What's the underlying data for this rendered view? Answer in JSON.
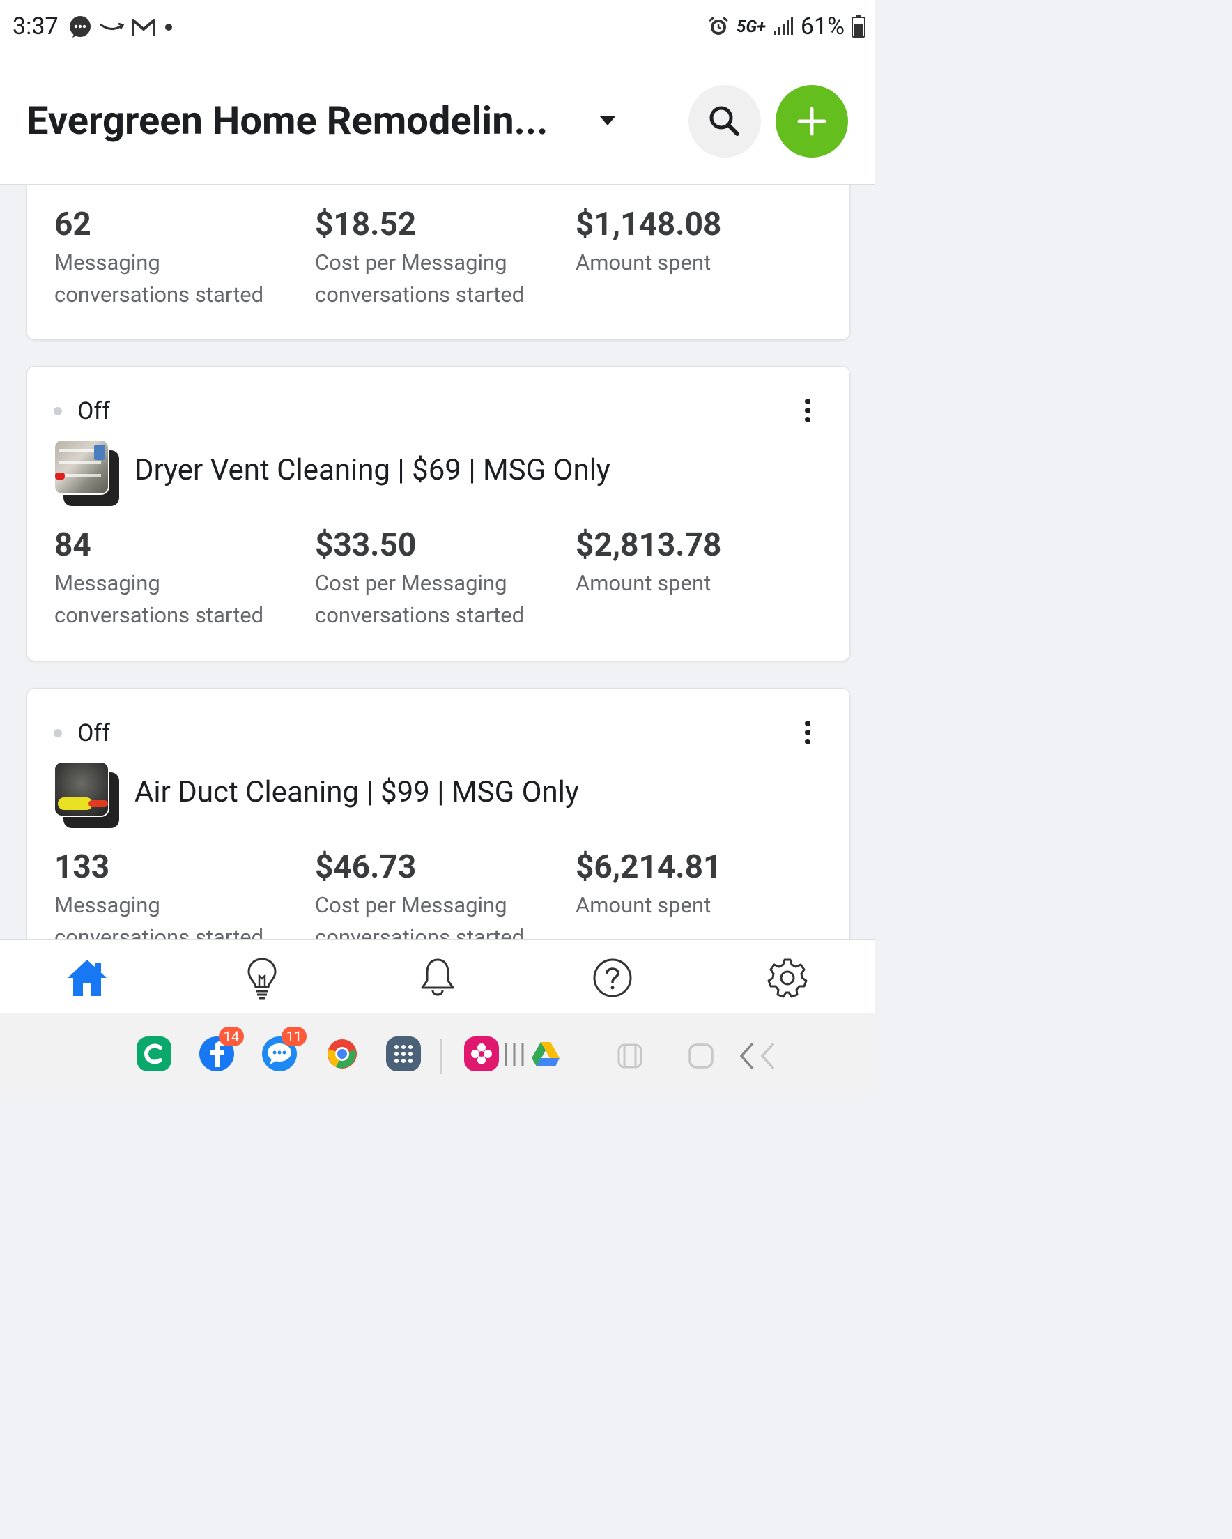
{
  "status_bar": {
    "time": "3:37",
    "network": "5G+",
    "battery": "61%"
  },
  "header": {
    "title": "Evergreen Home Remodelin...",
    "accent_color": "#63be1e"
  },
  "cards": [
    {
      "metrics": [
        {
          "value": "62",
          "label_line1": "Messaging",
          "label_line2": "conversations started"
        },
        {
          "value": "$18.52",
          "label_line1": "Cost per Messaging",
          "label_line2": "conversations started"
        },
        {
          "value": "$1,148.08",
          "label_line1": "Amount spent",
          "label_line2": ""
        }
      ]
    },
    {
      "status": "Off",
      "name": "Dryer Vent Cleaning | $69 | MSG Only",
      "metrics": [
        {
          "value": "84",
          "label_line1": "Messaging",
          "label_line2": "conversations started"
        },
        {
          "value": "$33.50",
          "label_line1": "Cost per Messaging",
          "label_line2": "conversations started"
        },
        {
          "value": "$2,813.78",
          "label_line1": "Amount spent",
          "label_line2": ""
        }
      ]
    },
    {
      "status": "Off",
      "name": "Air Duct Cleaning | $99 | MSG Only",
      "metrics": [
        {
          "value": "133",
          "label_line1": "Messaging",
          "label_line2": "conversations started"
        },
        {
          "value": "$46.73",
          "label_line1": "Cost per Messaging",
          "label_line2": "conversations started"
        },
        {
          "value": "$6,214.81",
          "label_line1": "Amount spent",
          "label_line2": ""
        }
      ]
    }
  ],
  "bottom_nav": [
    {
      "icon": "home-icon",
      "active": true
    },
    {
      "icon": "lightbulb-icon",
      "active": false
    },
    {
      "icon": "bell-icon",
      "active": false
    },
    {
      "icon": "help-icon",
      "active": false
    },
    {
      "icon": "gear-icon",
      "active": false
    }
  ],
  "dock": {
    "facebook_badge": "14",
    "messages_badge": "11"
  }
}
